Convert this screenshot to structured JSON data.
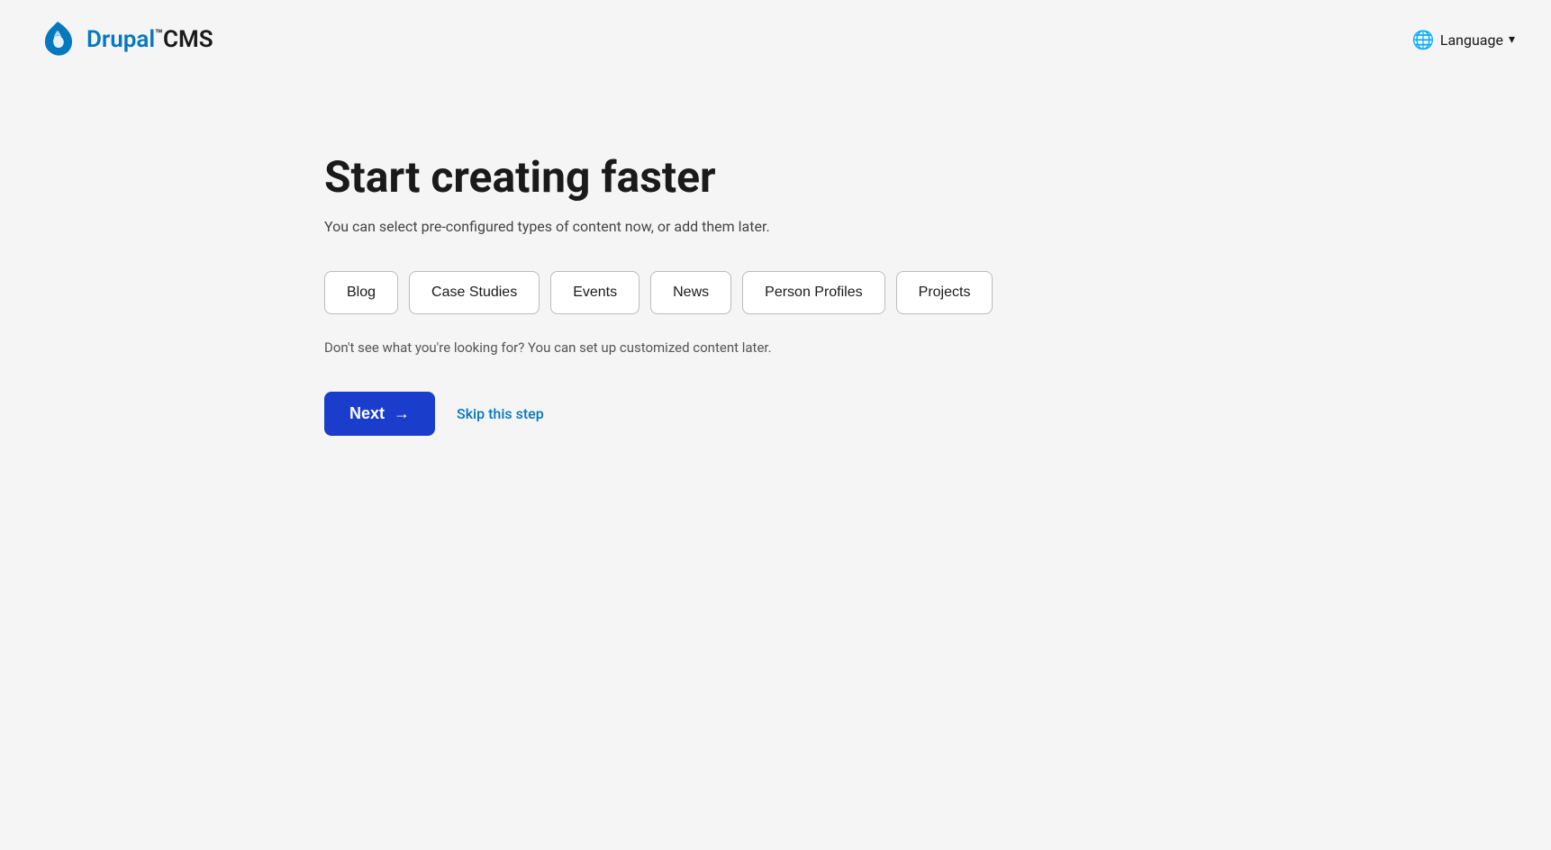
{
  "header": {
    "logo_text": "Drupal™CMS",
    "logo_drupal": "Drupal",
    "logo_tm": "™",
    "logo_cms": "CMS",
    "language_label": "Language",
    "language_icon": "🌐"
  },
  "main": {
    "title": "Start creating faster",
    "subtitle": "You can select pre-configured types of content now, or add them later.",
    "content_types": [
      {
        "id": "blog",
        "label": "Blog"
      },
      {
        "id": "case-studies",
        "label": "Case Studies"
      },
      {
        "id": "events",
        "label": "Events"
      },
      {
        "id": "news",
        "label": "News"
      },
      {
        "id": "person-profiles",
        "label": "Person Profiles"
      },
      {
        "id": "projects",
        "label": "Projects"
      }
    ],
    "helper_text": "Don't see what you're looking for? You can set up customized content later.",
    "next_button_label": "Next",
    "next_arrow": "→",
    "skip_label": "Skip this step"
  }
}
